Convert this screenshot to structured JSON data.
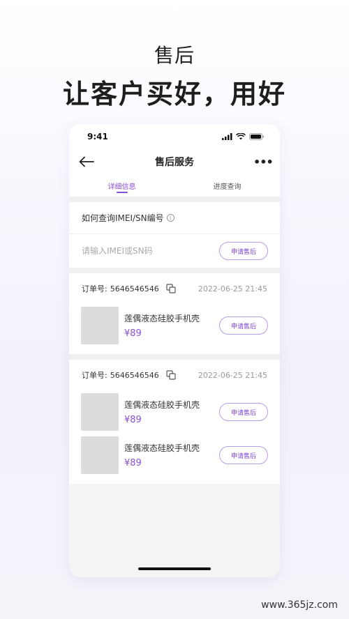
{
  "promo": {
    "subtitle": "售后",
    "title": "让客户买好，用好"
  },
  "status_bar": {
    "time": "9:41"
  },
  "nav": {
    "title": "售后服务",
    "more": "•••"
  },
  "tabs": [
    {
      "label": "详细信息",
      "active": true
    },
    {
      "label": "进度查询",
      "active": false
    }
  ],
  "imei": {
    "heading": "如何查询IMEI/SN编号",
    "info_glyph": "i",
    "placeholder": "请输入IMEI或SN码",
    "button": "申请售后"
  },
  "orders": [
    {
      "label": "订单号:",
      "number": "5646546546",
      "time": "2022-06-25  21:45",
      "items": [
        {
          "name": "莲偶液态硅胶手机壳",
          "price": "¥89",
          "button": "申请售后"
        }
      ]
    },
    {
      "label": "订单号:",
      "number": "5646546546",
      "time": "2022-06-25  21:45",
      "items": [
        {
          "name": "莲偶液态硅胶手机壳",
          "price": "¥89",
          "button": "申请售后"
        },
        {
          "name": "莲偶液态硅胶手机壳",
          "price": "¥89",
          "button": "申请售后"
        }
      ]
    }
  ],
  "watermark": "www.365jz.com",
  "colors": {
    "accent": "#8b4fd6",
    "button_border": "#b99ce6",
    "thumb": "#dcdcdc"
  }
}
